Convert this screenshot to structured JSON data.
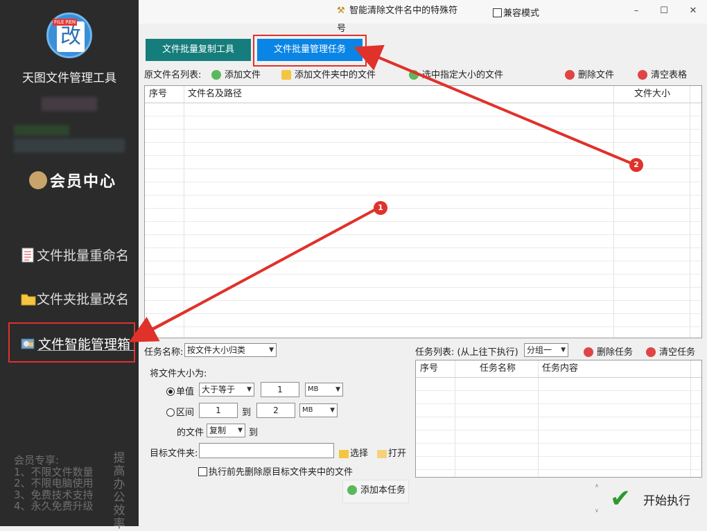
{
  "sidebar": {
    "logo_tag": "FILE REN",
    "logo_char": "改",
    "app_title": "天图文件管理工具",
    "member_center": "会员中心",
    "nav": [
      {
        "label": "文件批量重命名",
        "icon": "document-list-icon"
      },
      {
        "label": "文件夹批量改名",
        "icon": "folder-icon"
      },
      {
        "label": "文件智能管理箱",
        "icon": "smart-manager-icon"
      }
    ],
    "member_perks": [
      "会员专享:",
      "1、不限文件数量",
      "2、不限电脑使用",
      "3、免费技术支持",
      "4、永久免费升级"
    ],
    "slogan": "提高办公效率"
  },
  "titlebar": {
    "special_chars_label": "智能清除文件名中的特殊符号",
    "compat_label": "兼容模式",
    "compat_checked": false,
    "min_symbol": "–",
    "max_symbol": "☐",
    "close_symbol": "✕"
  },
  "tabs": [
    {
      "label": "文件批量复制工具",
      "active": false
    },
    {
      "label": "文件批量管理任务",
      "active": true
    }
  ],
  "toolbar": {
    "list_label": "原文件名列表:",
    "add_file": "添加文件",
    "add_folder": "添加文件夹中的文件",
    "select_size": "选中指定大小的文件",
    "delete_file": "删除文件",
    "clear_table": "清空表格"
  },
  "file_table": {
    "columns": [
      "序号",
      "文件名及路径",
      "文件大小"
    ],
    "rows": []
  },
  "task": {
    "name_label": "任务名称:",
    "name_value": "按文件大小归类",
    "size_label": "将文件大小为:",
    "single_label": "单值",
    "single_selected": true,
    "single_op": "大于等于",
    "single_value": "1",
    "single_unit": "MB",
    "range_label": "区间",
    "range_from": "1",
    "range_to_label": "到",
    "range_to": "2",
    "range_unit": "MB",
    "of_files_label": "的文件",
    "action_value": "复制",
    "to_label": "到",
    "target_label": "目标文件夹:",
    "target_value": "",
    "choose_label": "选择",
    "open_label": "打开",
    "delete_before_label": "执行前先删除原目标文件夹中的文件",
    "add_task_label": "添加本任务"
  },
  "task_list": {
    "label": "任务列表: (从上往下执行)",
    "group_value": "分组一",
    "delete_task": "删除任务",
    "clear_tasks": "清空任务",
    "columns": [
      "序号",
      "任务名称",
      "任务内容"
    ],
    "rows": []
  },
  "start_label": "开始执行",
  "annotations": [
    "1",
    "2"
  ],
  "colors": {
    "accent_red": "#e0312b",
    "tab_teal": "#157d7b",
    "tab_blue": "#0a85e6",
    "sidebar_bg": "#2b2b2b"
  }
}
